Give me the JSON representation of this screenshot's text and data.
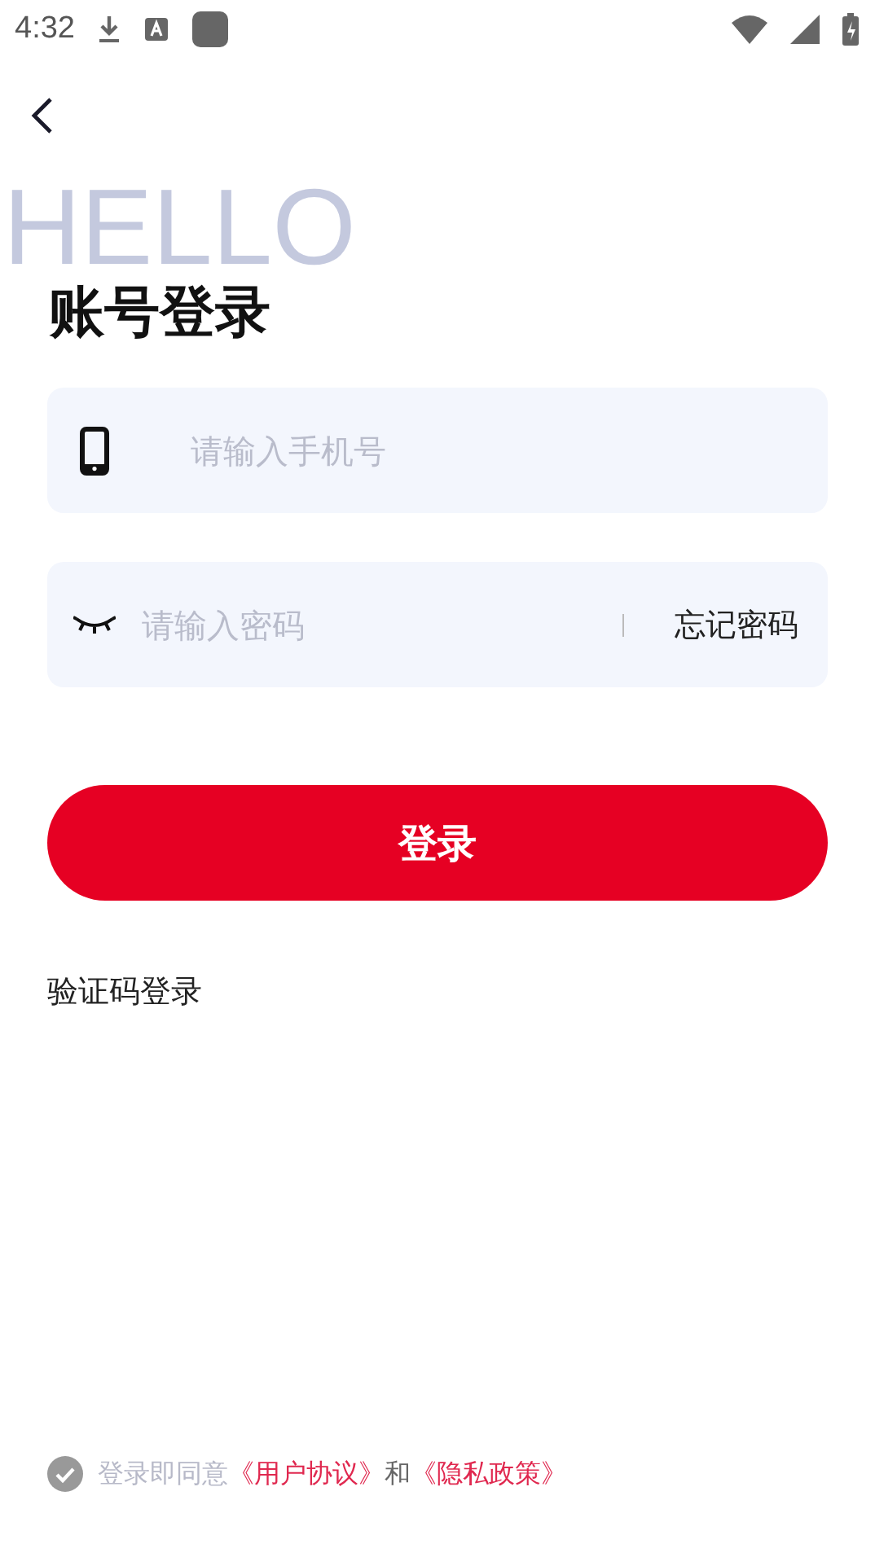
{
  "status_bar": {
    "time": "4:32"
  },
  "background_word": "HELLO",
  "title": "账号登录",
  "phone_field": {
    "placeholder": "请输入手机号"
  },
  "password_field": {
    "placeholder": "请输入密码",
    "password_visible": false,
    "forgot_link": "忘记密码"
  },
  "login_button": "登录",
  "alt_login_link": "验证码登录",
  "agreement": {
    "agreed": false,
    "prefix": "登录即同意",
    "links": [
      "《用户协议》",
      "《隐私政策》"
    ],
    "joiner": "和"
  }
}
